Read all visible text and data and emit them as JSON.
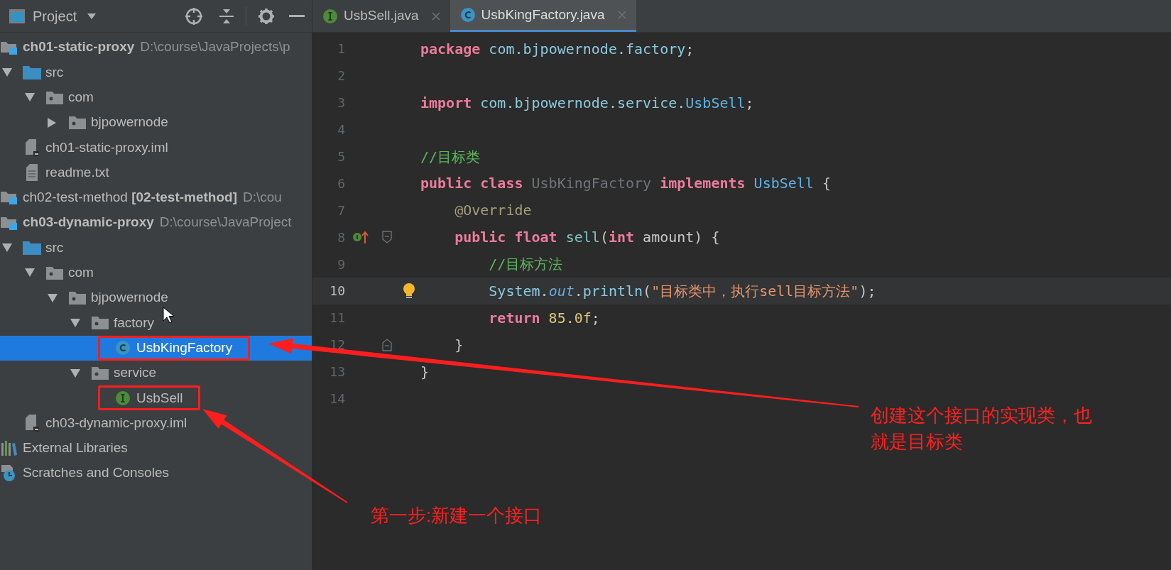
{
  "sidebar": {
    "title": "Project",
    "tree": [
      {
        "name": "ch01-static-proxy",
        "bold": true,
        "path": "D:\\course\\JavaProjects\\p",
        "kind": "module",
        "selected": false,
        "children": [
          {
            "name": "src",
            "kind": "source_folder",
            "expanded": true,
            "selected": false,
            "children": [
              {
                "name": "com",
                "kind": "package",
                "expanded": true,
                "selected": false,
                "children": [
                  {
                    "name": "bjpowernode",
                    "kind": "package",
                    "expanded": false,
                    "selected": false
                  }
                ]
              }
            ]
          },
          {
            "name": "ch01-static-proxy.iml",
            "kind": "iml",
            "selected": false
          },
          {
            "name": "readme.txt",
            "kind": "text",
            "selected": false
          }
        ]
      },
      {
        "name": "ch02-test-method **[02-test-method]**",
        "bold": false,
        "path": "D:\\cou",
        "kind": "module",
        "selected": false
      },
      {
        "name": "ch03-dynamic-proxy",
        "bold": true,
        "path": "D:\\course\\JavaProject",
        "kind": "module",
        "selected": false,
        "children": [
          {
            "name": "src",
            "kind": "source_folder",
            "expanded": true,
            "selected": false,
            "children": [
              {
                "name": "com",
                "kind": "package",
                "expanded": true,
                "selected": false,
                "children": [
                  {
                    "name": "bjpowernode",
                    "kind": "package",
                    "expanded": true,
                    "selected": false,
                    "children": [
                      {
                        "name": "factory",
                        "kind": "package",
                        "expanded": true,
                        "selected": false,
                        "children": [
                          {
                            "name": "UsbKingFactory",
                            "kind": "class",
                            "selected": true,
                            "boxed": true
                          }
                        ]
                      },
                      {
                        "name": "service",
                        "kind": "package",
                        "expanded": true,
                        "selected": false,
                        "children": [
                          {
                            "name": "UsbSell",
                            "kind": "interface",
                            "selected": false,
                            "boxed": true
                          }
                        ]
                      }
                    ]
                  }
                ]
              }
            ]
          },
          {
            "name": "ch03-dynamic-proxy.iml",
            "kind": "iml",
            "selected": false
          }
        ]
      },
      {
        "name": "External Libraries",
        "kind": "libraries",
        "selected": false
      },
      {
        "name": "Scratches and Consoles",
        "kind": "scratches",
        "selected": false
      }
    ]
  },
  "tabs": [
    {
      "label": "UsbSell.java",
      "kind": "interface",
      "selected": false
    },
    {
      "label": "UsbKingFactory.java",
      "kind": "class",
      "selected": true
    }
  ],
  "editor": {
    "lines": [
      {
        "number": "1",
        "tokens": [
          {
            "t": "package",
            "kind": "kw"
          },
          {
            "t": " com.bjpowernode.factory",
            "kind": "ident"
          },
          {
            "t": ";",
            "kind": "plain"
          }
        ]
      },
      {
        "number": "2"
      },
      {
        "number": "3",
        "tokens": [
          {
            "t": "import",
            "kind": "kw"
          },
          {
            "t": " com.bjpowernode.service.",
            "kind": "ident"
          },
          {
            "t": "UsbSell",
            "kind": "type"
          },
          {
            "t": ";",
            "kind": "plain"
          }
        ]
      },
      {
        "number": "4"
      },
      {
        "number": "5",
        "tokens": [
          {
            "t": "//目标类",
            "kind": "comment"
          }
        ]
      },
      {
        "number": "6",
        "tokens": [
          {
            "t": "public class",
            "kind": "kw"
          },
          {
            "t": " UsbKingFactory ",
            "kind": "unused"
          },
          {
            "t": "implements",
            "kind": "kw"
          },
          {
            "t": " UsbSell",
            "kind": "type"
          },
          {
            "t": " {",
            "kind": "plain"
          }
        ]
      },
      {
        "number": "7",
        "tokens": [
          {
            "t": "    @Override",
            "kind": "annotation"
          }
        ]
      },
      {
        "number": "8",
        "gutter": [
          {
            "kind": "override"
          },
          {
            "kind": "fold_start"
          }
        ],
        "tokens": [
          {
            "t": "    public float",
            "kind": "kw"
          },
          {
            "t": " sell",
            "kind": "method"
          },
          {
            "t": "(",
            "kind": "plain"
          },
          {
            "t": "int",
            "kind": "kw"
          },
          {
            "t": " amount) {",
            "kind": "plain"
          }
        ]
      },
      {
        "number": "9",
        "tokens": [
          {
            "t": "        //目标方法",
            "kind": "comment"
          }
        ]
      },
      {
        "number": "10",
        "current": true,
        "gutter": [
          {
            "kind": "bulb"
          }
        ],
        "tokens": [
          {
            "t": "        System",
            "kind": "ident"
          },
          {
            "t": ".",
            "kind": "plain"
          },
          {
            "t": "out",
            "kind": "field"
          },
          {
            "t": ".",
            "kind": "plain"
          },
          {
            "t": "println",
            "kind": "ident"
          },
          {
            "t": "(",
            "kind": "plain"
          },
          {
            "t": "\"目标类中，执行sell目标方法\"",
            "kind": "string"
          },
          {
            "t": ");",
            "kind": "plain"
          }
        ]
      },
      {
        "number": "11",
        "tokens": [
          {
            "t": "        return",
            "kind": "kw"
          },
          {
            "t": " 85.0f",
            "kind": "number"
          },
          {
            "t": ";",
            "kind": "plain"
          }
        ]
      },
      {
        "number": "12",
        "gutter": [
          {
            "kind": "fold_end"
          }
        ],
        "tokens": [
          {
            "t": "    }",
            "kind": "plain"
          }
        ]
      },
      {
        "number": "13",
        "tokens": [
          {
            "t": "}",
            "kind": "plain"
          }
        ]
      },
      {
        "number": "14"
      }
    ]
  },
  "notes": [
    "创建这个接口的实现类，也就是目标类",
    "第一步:新建一个接口"
  ]
}
